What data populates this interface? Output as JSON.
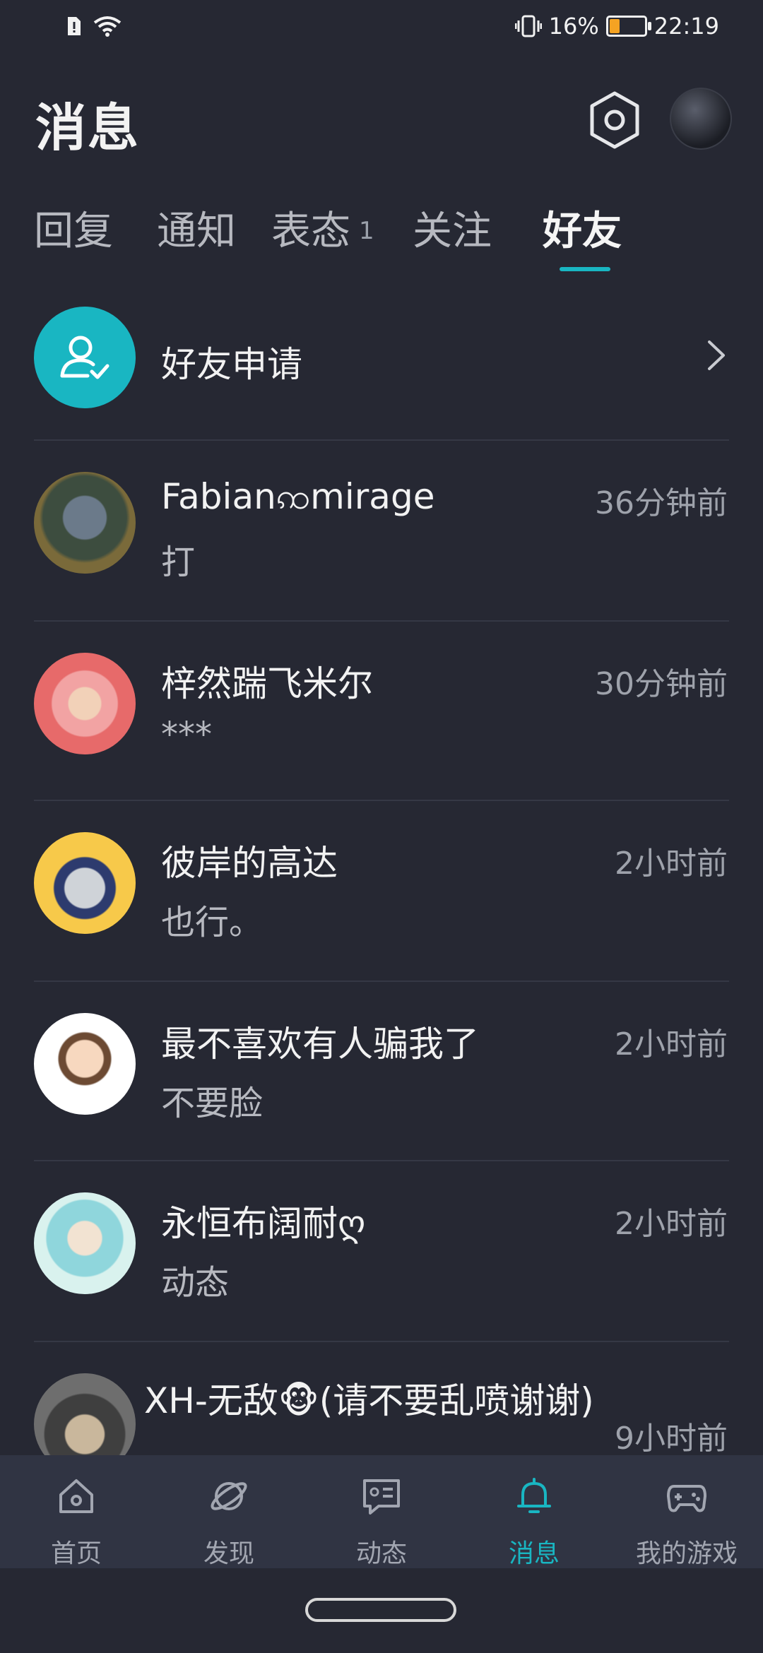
{
  "status_bar": {
    "battery_percent": "16%",
    "time": "22:19"
  },
  "header": {
    "title": "消息"
  },
  "tabs": [
    {
      "label": "回复"
    },
    {
      "label": "通知"
    },
    {
      "label": "表态",
      "badge": "1"
    },
    {
      "label": "关注"
    },
    {
      "label": "好友",
      "active": true
    }
  ],
  "friend_request": {
    "label": "好友申请"
  },
  "chats": [
    {
      "name": "Fabianꩡmirage",
      "message": "打",
      "time": "36分钟前"
    },
    {
      "name": "梓然踹飞米尔",
      "message": "***",
      "time": "30分钟前"
    },
    {
      "name": "彼岸的高达",
      "message": "也行。",
      "time": "2小时前"
    },
    {
      "name": "最不喜欢有人骗我了",
      "message": "不要脸",
      "time": "2小时前"
    },
    {
      "name": "永恒布阔耐ღ",
      "message": "动态",
      "time": "2小时前"
    },
    {
      "name": "XH-无敌🐵(请不要乱喷谢谢)",
      "message": "",
      "time": "9小时前"
    }
  ],
  "tab_bar": [
    {
      "label": "首页",
      "icon": "home-icon"
    },
    {
      "label": "发现",
      "icon": "planet-icon"
    },
    {
      "label": "动态",
      "icon": "chat-card-icon"
    },
    {
      "label": "消息",
      "icon": "bell-icon",
      "active": true
    },
    {
      "label": "我的游戏",
      "icon": "gamepad-icon"
    }
  ],
  "colors": {
    "accent": "#19b6c2",
    "background": "#262833",
    "tab_bar_bg": "#303443"
  }
}
